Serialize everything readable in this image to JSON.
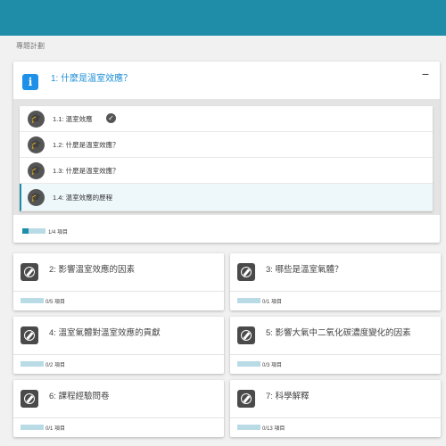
{
  "section_label": "專題計劃",
  "main": {
    "title": "1: 什麼是溫室效應？",
    "collapse_symbol": "−",
    "items": [
      {
        "label": "1.1: 溫室效應",
        "completed": true
      },
      {
        "label": "1.2: 什麼是溫室效應？",
        "completed": false
      },
      {
        "label": "1.3: 什麼是溫室效應？",
        "completed": false
      },
      {
        "label": "1.4: 溫室效應的歷程",
        "completed": false,
        "active": true
      }
    ],
    "progress_text": "1/4 項目",
    "progress_fraction": 0.25
  },
  "cards": [
    {
      "title": "2: 影響溫室效應的因素",
      "progress_text": "0/5 項目"
    },
    {
      "title": "3: 哪些是溫室氣體？",
      "progress_text": "0/1 項目"
    },
    {
      "title": "4: 溫室氣體對溫室效應的貢獻",
      "progress_text": "0/2 項目"
    },
    {
      "title": "5: 影響大氣中二氧化碳濃度變化的因素",
      "progress_text": "0/3 項目"
    },
    {
      "title": "6: 課程經驗問卷",
      "progress_text": "0/1 項目"
    },
    {
      "title": "7: 科學解釋",
      "progress_text": "0/13 項目"
    }
  ],
  "colors": {
    "header": "#1f8ca8",
    "accent": "#1e8fd6",
    "progress_bg": "#b8dbe6"
  }
}
